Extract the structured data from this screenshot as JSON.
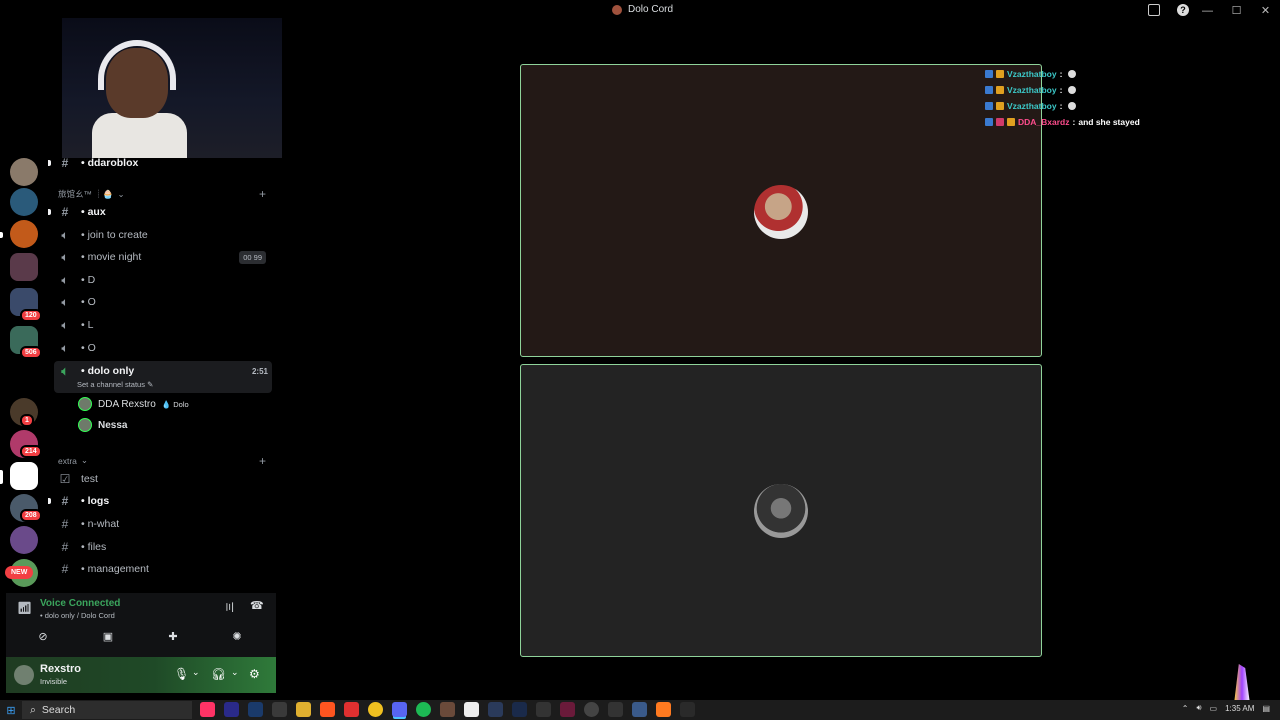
{
  "window": {
    "title": "Dolo Cord"
  },
  "channels": {
    "top_channel": "ddaroblox",
    "category1": "旅馆ㄠ™ ┊🧁",
    "items": [
      {
        "label": "aux"
      },
      {
        "label": "join to create"
      },
      {
        "label": "movie night",
        "tag": "00 99"
      },
      {
        "label": "D"
      },
      {
        "label": "O"
      },
      {
        "label": "L"
      },
      {
        "label": "O"
      },
      {
        "label": "dolo only",
        "timer": "2:51"
      }
    ],
    "status_placeholder": "Set a channel status",
    "voice_users": [
      {
        "name": "DDA Rexstro",
        "extra": "Dolo"
      },
      {
        "name": "Nessa"
      }
    ],
    "category2": "extra",
    "items2": [
      {
        "label": "test"
      },
      {
        "label": "logs"
      },
      {
        "label": "n-what"
      },
      {
        "label": "files"
      },
      {
        "label": "management"
      }
    ]
  },
  "servers": {
    "badges": [
      "120",
      "506",
      "1",
      "214",
      "208"
    ],
    "new_label": "NEW"
  },
  "voice": {
    "status": "Voice Connected",
    "location": "• dolo only / Dolo Cord"
  },
  "user": {
    "name": "Rexstro",
    "status": "Invisible"
  },
  "chat": [
    {
      "name": "Vzazthatboy",
      "text": ""
    },
    {
      "name": "Vzazthatboy",
      "text": ""
    },
    {
      "name": "Vzazthatboy",
      "text": ""
    },
    {
      "name": "DDA_Bxardz",
      "text": "and she stayed"
    }
  ],
  "taskbar": {
    "search_placeholder": "Search",
    "time": "1:35 AM"
  },
  "colors": {
    "accent_green": "#3ba55d",
    "tile_border": "#8fd39a",
    "chat_teal": "#3cc8c8",
    "chat_pink": "#ff4d8d"
  }
}
